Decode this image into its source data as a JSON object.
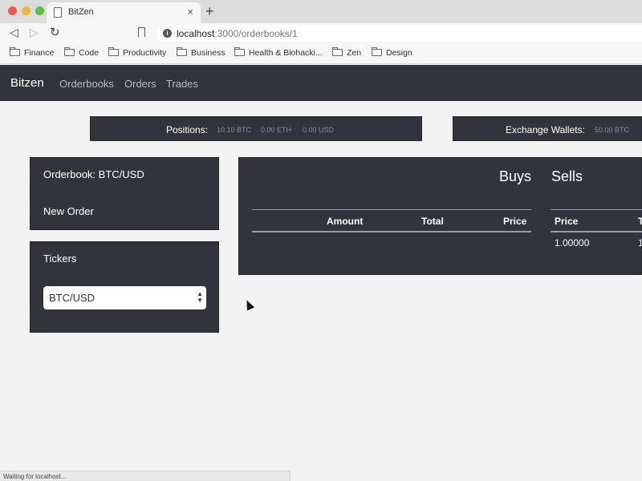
{
  "browser": {
    "tab_title": "BitZen",
    "tab_close": "×",
    "new_tab": "+",
    "url_host": "localhost",
    "url_path": ":3000/orderbooks/1",
    "bookmarks": [
      {
        "label": "Finance"
      },
      {
        "label": "Code"
      },
      {
        "label": "Productivity"
      },
      {
        "label": "Business"
      },
      {
        "label": "Health & Biohacki..."
      },
      {
        "label": "Zen"
      },
      {
        "label": "Design"
      }
    ],
    "status_text": "Waiting for localhost..."
  },
  "app": {
    "brand": "Bitzen",
    "nav": [
      {
        "label": "Orderbooks"
      },
      {
        "label": "Orders"
      },
      {
        "label": "Trades"
      }
    ],
    "positions": {
      "label": "Positions:",
      "values": [
        "10.10 BTC",
        "0.00 ETH",
        "0.00 USD"
      ]
    },
    "wallets": {
      "label": "Exchange Wallets:",
      "values": [
        "50.00 BTC"
      ]
    },
    "orderbook_panel": {
      "title": "Orderbook: BTC/USD",
      "new_order": "New Order"
    },
    "tickers_panel": {
      "title": "Tickers",
      "selected": "BTC/USD"
    },
    "buys": {
      "heading": "Buys",
      "columns": [
        "Amount",
        "Total",
        "Price"
      ]
    },
    "sells": {
      "heading": "Sells",
      "columns": [
        "Price",
        "T"
      ],
      "rows": [
        [
          "1.00000",
          "1"
        ]
      ]
    }
  },
  "colors": {
    "navbar": "#31343a",
    "panel": "#31343a",
    "page_background": "#f3f3f4"
  }
}
